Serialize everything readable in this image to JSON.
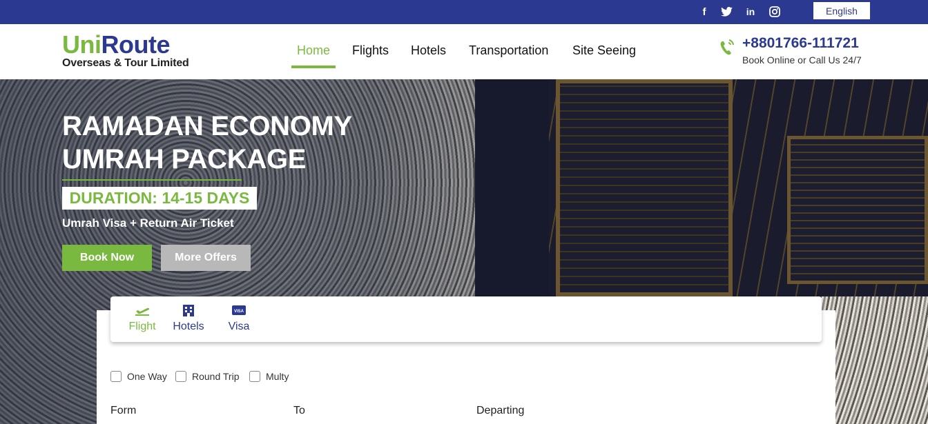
{
  "topbar": {
    "social": [
      {
        "name": "facebook-icon",
        "glyph": "f"
      },
      {
        "name": "twitter-icon",
        "glyph": "t"
      },
      {
        "name": "linkedin-icon",
        "glyph": "in"
      },
      {
        "name": "instagram-icon",
        "glyph": "◎"
      }
    ],
    "language": "English"
  },
  "header": {
    "logo": {
      "uni": "Uni",
      "route": "Route",
      "subtitle": "Overseas & Tour Limited"
    },
    "nav": [
      "Home",
      "Flights",
      "Hotels",
      "Transportation",
      "Site Seeing"
    ],
    "active_nav": "Home",
    "phone": "+8801766-111721",
    "phone_sub": "Book Online or Call Us 24/7"
  },
  "hero": {
    "title_line1": "RAMADAN ECONOMY",
    "title_line2": "UMRAH PACKAGE",
    "duration": "DURATION: 14-15 DAYS",
    "subtitle": "Umrah Visa + Return Air Ticket",
    "book_now": "Book Now",
    "more_offers": "More Offers"
  },
  "search": {
    "tabs": [
      {
        "label": "Flight",
        "icon": "plane-icon"
      },
      {
        "label": "Hotels",
        "icon": "building-icon"
      },
      {
        "label": "Visa",
        "icon": "visa-card-icon"
      }
    ],
    "active_tab": "Flight",
    "trip_types": [
      "One Way",
      "Round Trip",
      "Multy"
    ],
    "fields": {
      "from": "Form",
      "to": "To",
      "departing": "Departing"
    }
  },
  "colors": {
    "primary": "#2b3990",
    "accent": "#7ab940",
    "muted_button": "#b8b8b8"
  }
}
